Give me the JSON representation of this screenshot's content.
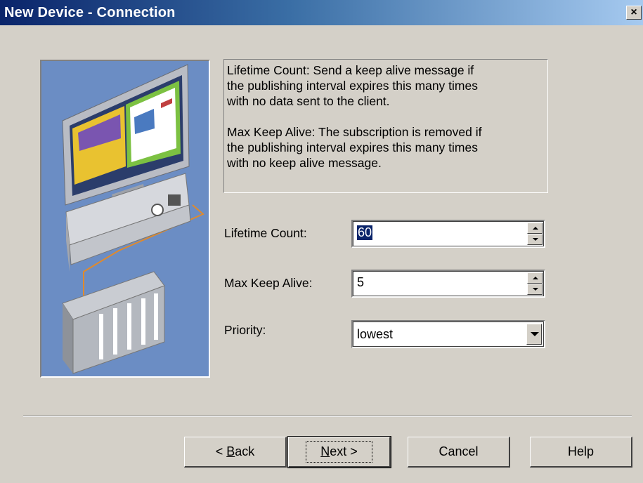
{
  "window": {
    "title": "New Device - Connection",
    "close_glyph": "×"
  },
  "description": {
    "lifetime_text": "Lifetime Count: Send a keep alive message if\nthe publishing interval expires this many times\nwith no data sent to the client.",
    "keepalive_text": "Max Keep Alive: The subscription is removed if\nthe publishing interval expires this many times\nwith no keep alive message."
  },
  "fields": {
    "lifetime_label": "Lifetime Count:",
    "lifetime_value": "60",
    "keepalive_label": "Max Keep Alive:",
    "keepalive_value": "5",
    "priority_label": "Priority:",
    "priority_value": "lowest"
  },
  "buttons": {
    "back_prefix": "< ",
    "back_mnemonic": "B",
    "back_rest": "ack",
    "next_mnemonic": "N",
    "next_rest": "ext >",
    "cancel": "Cancel",
    "help": "Help"
  },
  "icons": {
    "close": "close-icon",
    "spin_up": "spin-up-icon",
    "spin_down": "spin-down-icon",
    "dropdown": "chevron-down-icon",
    "illustration": "computer-network-illustration"
  },
  "colors": {
    "face": "#d4d0c8",
    "title_start": "#0a246a",
    "title_end": "#a6caf0",
    "illustration_bg": "#6b8dc4",
    "selection": "#0a246a"
  }
}
